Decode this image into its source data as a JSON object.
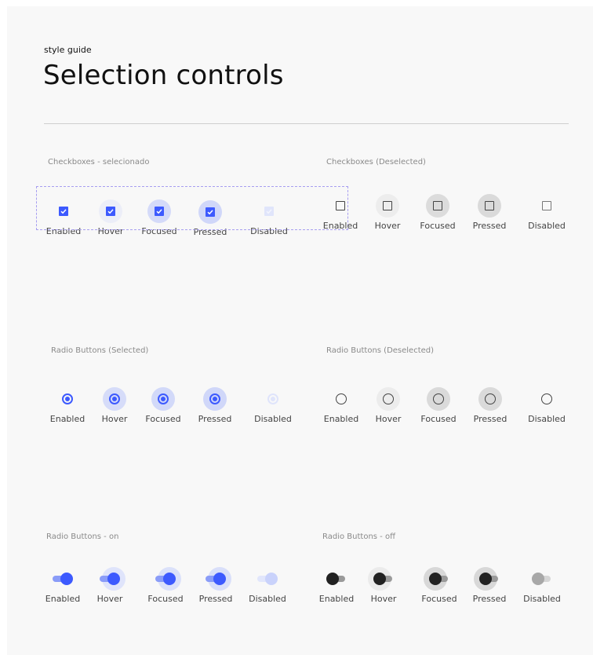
{
  "page": {
    "eyebrow": "style guide",
    "title": "Selection controls"
  },
  "states": {
    "enabled": "Enabled",
    "hover": "Hover",
    "focused": "Focused",
    "pressed": "Pressed",
    "disabled": "Disabled"
  },
  "sections": {
    "checkboxes_selected": "Checkboxes - selecionado",
    "checkboxes_deselected": "Checkboxes (Deselected)",
    "radio_selected": "Radio Buttons (Selected)",
    "radio_deselected": "Radio Buttons (Deselected)",
    "switch_on": "Radio Buttons - on",
    "switch_off": "Radio Buttons - off"
  },
  "colors": {
    "accent": "#3d5afe",
    "accent_light": "#dfe4fb",
    "canvas": "#f8f8f8",
    "selection_outline": "#a79ef0"
  },
  "icons": {
    "checkmark": "check-icon"
  }
}
